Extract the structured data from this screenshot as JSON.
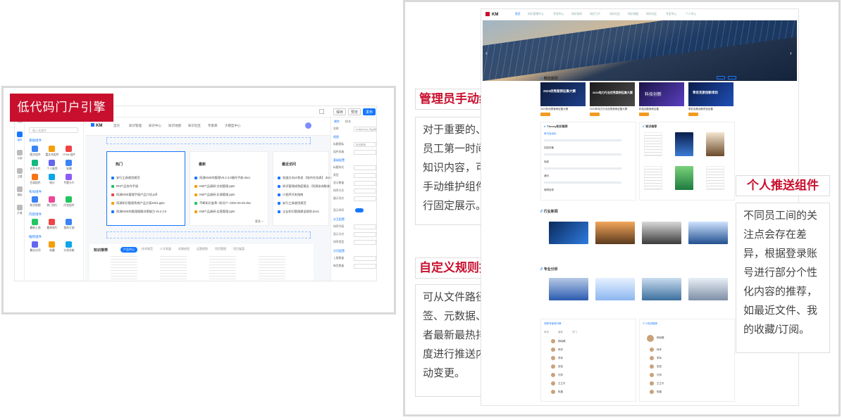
{
  "left": {
    "badge": "低代码门户引擎",
    "editor": {
      "toolbar": {
        "undo": "保存",
        "preview": "预览",
        "publish": "发布"
      },
      "rail": [
        "页面",
        "组件",
        "大纲",
        "主题",
        "模板",
        "扩展"
      ],
      "component_search_placeholder": "输入关键字",
      "component_sections": [
        "基础组件",
        "布局组件",
        "内容组件",
        "推荐组件"
      ],
      "component_labels": [
        "图文组件",
        "富文本组件",
        "HTML组件",
        "文件卡片",
        "个人推荐",
        "轮播",
        "目录组件",
        "统计",
        "专题卡片",
        "知识地图",
        "热门排行",
        "问答组件",
        "最新上线",
        "最热排行",
        "我的订阅",
        "最近访问",
        "收藏",
        "分类导航"
      ],
      "canvas_nav": [
        "首页",
        "知识管理",
        "知识中心",
        "知识地图",
        "知识社区",
        "专家库",
        "大模型中心"
      ],
      "card_titles": {
        "hot": "热门",
        "latest": "最新",
        "recent": "最近访问"
      },
      "hot_rows": [
        "安行工具使用规范",
        "RH产品合作手册",
        "同源KMS管理手册产品介绍.pdf",
        "同源知识管理系统产品方案2024.pptx",
        "同源KMS的管理理解决策能力 v5.2.3.0"
      ],
      "latest_rows": [
        "同源KMS的管理V5.2.3.0操作手册.docx",
        "KM产品调研-文档管理.pptx",
        "KM产品调研-反馈管理.pptx",
        "不断知识变革--知识产--2024-03-28.xlsx",
        "KM产品调研-运营管理.pptx"
      ],
      "recent_rows": [
        "发展方向计划说 【协作任务表】.docx",
        "知识管理成熟度报告（同源咨询版本）",
        "小程序开发指南",
        "安行工具使用规范",
        "企业知识管理建设规划.docx"
      ],
      "more": "更多 >",
      "rec_title": "知识推荐",
      "rec_tabs": [
        "产品中心",
        "技术规范",
        "人才发展",
        "实践经验",
        "运营规划",
        "项目管理",
        "项目复盘"
      ],
      "props_tabs": [
        "属性",
        "样式"
      ],
      "props": {
        "sections": [
          "视图",
          "基础配置",
          "交互配置",
          "分页配置"
        ],
        "labels": [
          "名称",
          "标题图标",
          "组件风格",
          "标题样式",
          "类型",
          "显示数量",
          "排序方式",
          "展示形式",
          "显示时间",
          "排序字段",
          "显示方式",
          "排序类型",
          "上限数量",
          "每页数量"
        ],
        "name_value": "知识推荐",
        "name_key": "kmtplcomp_Rgg5hxm7q8"
      }
    }
  },
  "right": {
    "sections": [
      {
        "title": "管理员手动维护组件",
        "desc": "对于重要的、需要让员工第一时间找到的知识内容，可以通过手动维护组件对其进行固定展示。"
      },
      {
        "title": "自定义规则推送组件",
        "desc": "可从文件路径、标签、元数据、专辑或者最新最热排序等维度进行推送内容的自动变更。"
      },
      {
        "title": "个人推送组件",
        "desc": "不同员工间的关注点会存在差异，根据登录账号进行部分个性化内容的推荐，如最近文件、我的收藏/订阅。"
      }
    ],
    "portal": {
      "logo": "KM",
      "nav": [
        "首页",
        "知识管理中心",
        "专项中心",
        "知识协同",
        "知识门户",
        "知识社区",
        "知识地图",
        "知识社区",
        "专家中心",
        "个人中心"
      ],
      "sections": [
        "精选案例",
        "Theory知识推荐",
        "知识推荐",
        "行业新闻",
        "专业分析",
        "领导专家排行榜",
        "个人知识推荐"
      ],
      "case_titles": [
        "2023优秀案例征集大赛",
        "2023电力行业优秀案例征集大赛",
        "科技创新",
        "草尼克斯创新项目"
      ],
      "case_captions": [
        "2023年优秀案例征集大赛",
        "2023年电力行业优秀案例征集大赛",
        "科技创新案例合集",
        "草尼克斯创新项目征集"
      ],
      "list_tabs": [
        "电气自动化",
        "控制设备",
        "电缆",
        "通讯",
        "故障检修"
      ],
      "news_tabs": [
        "案例",
        "最新",
        "热门"
      ],
      "names": [
        "杨晓曦",
        "林坪",
        "李军",
        "张哲",
        "刘洋",
        "王立平",
        "陈晨"
      ]
    }
  }
}
